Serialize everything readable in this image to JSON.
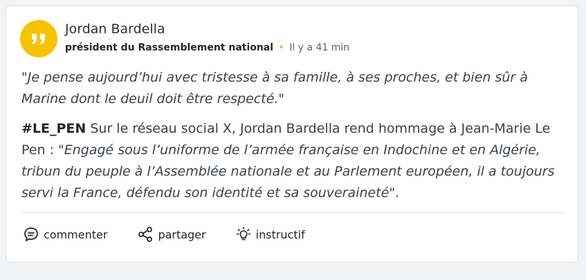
{
  "author": {
    "name": "Jordan Bardella",
    "role": "président du Rassemblement national",
    "separator": "•",
    "time_ago": "Il y a 41 min"
  },
  "post": {
    "quote": "\"Je pense aujourd’hui avec tristesse à sa famille, à ses proches, et bien sûr à Marine dont le deuil doit être respecté.\"",
    "tag": "#LE_PEN",
    "intro": " Sur le réseau social X, Jordan Bardella rend hommage à Jean-Marie Le Pen : ",
    "citation": "\"Engagé sous l’uniforme de l’armée française en Indochine et en Algérie, tribun du peuple à l’Assemblée nationale et au Parlement européen, il a toujours servi la France, défendu son identité et sa souveraineté\"",
    "citation_end": "."
  },
  "actions": {
    "comment_label": "commenter",
    "share_label": "partager",
    "insightful_label": "instructif"
  },
  "icons": {
    "avatar": "quote-marks-icon",
    "comment": "comment-bubble-icon",
    "share": "share-icon",
    "insightful": "lightbulb-icon"
  },
  "colors": {
    "accent": "#f7c200",
    "text": "#3b4050",
    "heading": "#1f2430"
  }
}
